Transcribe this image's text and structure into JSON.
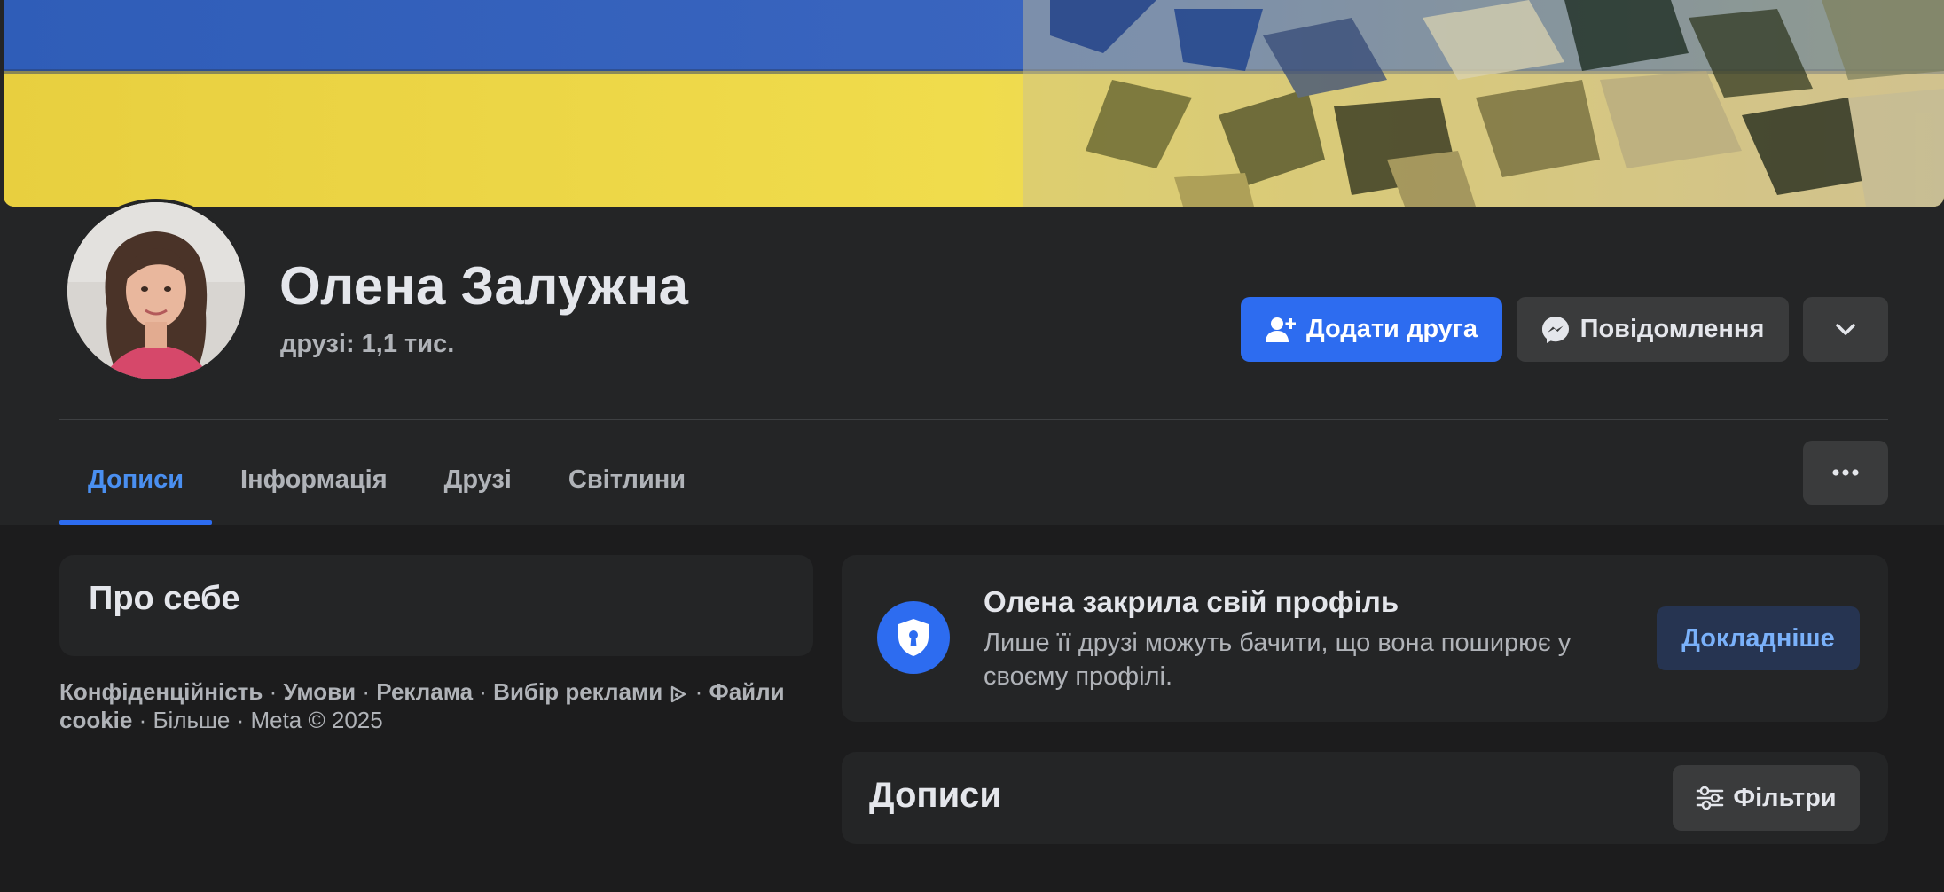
{
  "profile": {
    "name": "Олена Залужна",
    "friends": "друзі: 1,1 тис."
  },
  "actions": {
    "add_friend": "Додати друга",
    "message": "Повідомлення"
  },
  "tabs": [
    {
      "label": "Дописи",
      "active": true
    },
    {
      "label": "Інформація",
      "active": false
    },
    {
      "label": "Друзі",
      "active": false
    },
    {
      "label": "Світлини",
      "active": false
    }
  ],
  "about": {
    "title": "Про себе"
  },
  "footer": {
    "privacy": "Конфіденційність",
    "terms": "Умови",
    "ads": "Реклама",
    "ad_choices": "Вибір реклами",
    "cookies": "Файли cookie",
    "more": "Більше",
    "copyright": "Meta © 2025",
    "separator": " · "
  },
  "locked": {
    "title": "Олена закрила свій профіль",
    "description": "Лише її друзі можуть бачити, що вона поширює у своєму профілі.",
    "learn_more": "Докладніше"
  },
  "posts": {
    "title": "Дописи",
    "filters": "Фільтри"
  },
  "icons": {
    "add_friend": "person-plus-icon",
    "message": "messenger-icon",
    "more": "chevron-down-icon",
    "tab_more": "more-horizontal-icon",
    "privacy_shield": "shield-keyhole-icon",
    "ad_choices": "ad-choices-icon",
    "filters": "sliders-icon"
  },
  "colors": {
    "accent": "#2d6cf0",
    "background": "#1c1c1d",
    "surface": "#242526",
    "button_secondary": "#3a3b3c",
    "text_primary": "#e4e6eb",
    "text_secondary": "#b0b3b8",
    "link_blue": "#4a8ff0"
  }
}
